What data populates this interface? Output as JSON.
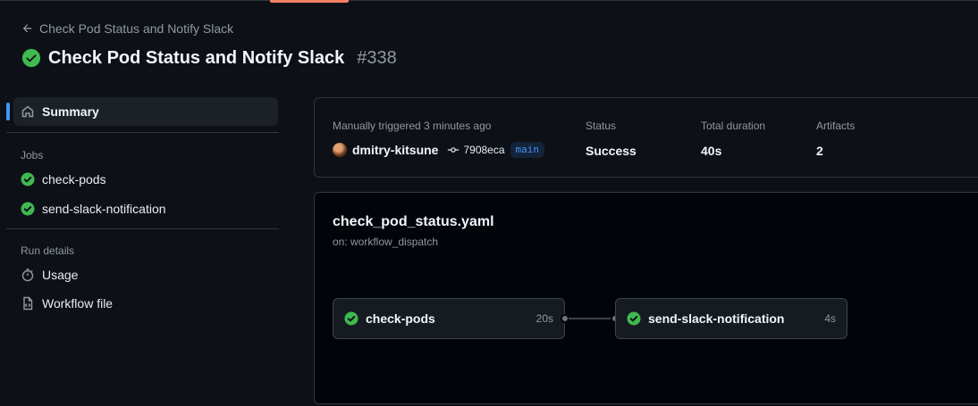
{
  "header": {
    "back_label": "Check Pod Status and Notify Slack",
    "title": "Check Pod Status and Notify Slack",
    "run_number": "#338"
  },
  "sidebar": {
    "summary_label": "Summary",
    "jobs_heading": "Jobs",
    "jobs": [
      {
        "label": "check-pods",
        "status": "success"
      },
      {
        "label": "send-slack-notification",
        "status": "success"
      }
    ],
    "run_details_heading": "Run details",
    "run_details": [
      {
        "label": "Usage",
        "icon": "stopwatch-icon"
      },
      {
        "label": "Workflow file",
        "icon": "file-code-icon"
      }
    ]
  },
  "summary": {
    "trigger_text": "Manually triggered 3 minutes ago",
    "actor": "dmitry-kitsune",
    "commit": "7908eca",
    "branch": "main",
    "status_label": "Status",
    "status_value": "Success",
    "duration_label": "Total duration",
    "duration_value": "40s",
    "artifacts_label": "Artifacts",
    "artifacts_value": "2"
  },
  "graph": {
    "workflow_file": "check_pod_status.yaml",
    "trigger": "on: workflow_dispatch",
    "jobs": [
      {
        "name": "check-pods",
        "duration": "20s"
      },
      {
        "name": "send-slack-notification",
        "duration": "4s"
      }
    ]
  },
  "colors": {
    "success": "#3fb950",
    "accent": "#4493f8",
    "background": "#0d1117",
    "border": "#30363d"
  }
}
